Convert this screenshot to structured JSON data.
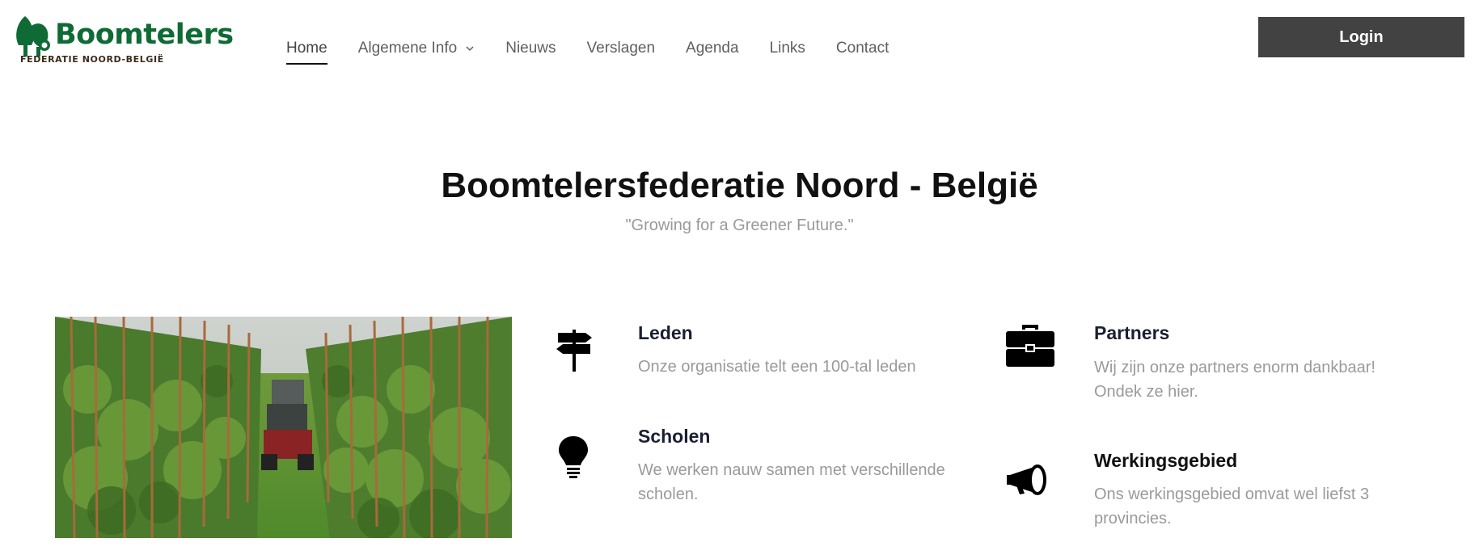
{
  "logo": {
    "name": "Boomtelers",
    "subtitle": "FEDERATIE NOORD-BELGIË",
    "colors": {
      "green": "#0f6b35",
      "brown": "#3b2a1a"
    }
  },
  "nav": {
    "items": [
      {
        "label": "Home",
        "active": true
      },
      {
        "label": "Algemene Info",
        "dropdown": true
      },
      {
        "label": "Nieuws"
      },
      {
        "label": "Verslagen"
      },
      {
        "label": "Agenda"
      },
      {
        "label": "Links"
      },
      {
        "label": "Contact"
      }
    ]
  },
  "login": {
    "label": "Login",
    "color": "#424242"
  },
  "hero": {
    "title": "Boomtelersfederatie Noord - België",
    "subtitle": "\"Growing for a Greener Future.\""
  },
  "photo": {
    "subject": "tree nursery rows with tractor"
  },
  "features": {
    "leden": {
      "icon": "signpost-icon",
      "title": "Leden",
      "text": "Onze organisatie telt een 100-tal leden"
    },
    "scholen": {
      "icon": "lightbulb-icon",
      "title": "Scholen",
      "text": "We werken nauw samen met verschillende scholen."
    },
    "partners": {
      "icon": "briefcase-icon",
      "title": "Partners",
      "text": "Wij zijn onze partners enorm dankbaar! Ondek ze hier."
    },
    "werkingsgebied": {
      "icon": "megaphone-icon",
      "title": "Werkingsgebied",
      "text": "Ons werkingsgebied omvat wel liefst 3 provincies."
    }
  }
}
